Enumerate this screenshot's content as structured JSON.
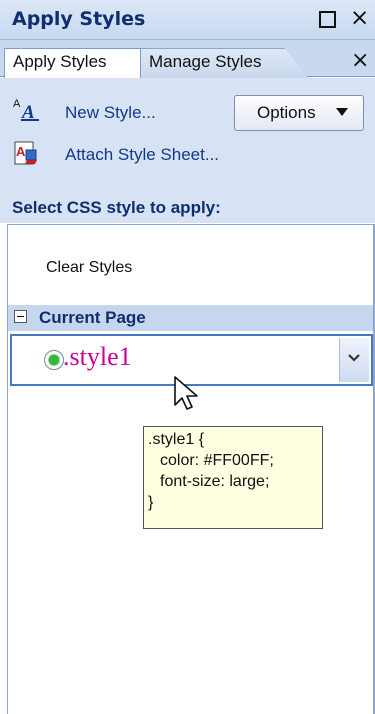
{
  "window": {
    "title": "Apply Styles"
  },
  "tabs": [
    {
      "label": "Apply Styles",
      "active": true
    },
    {
      "label": "Manage Styles",
      "active": false
    }
  ],
  "actions": {
    "new_style": "New Style...",
    "attach_style_sheet": "Attach Style Sheet...",
    "options": "Options"
  },
  "select_label": "Select CSS style to apply:",
  "list": {
    "clear_styles": "Clear Styles",
    "group_label": "Current Page",
    "items": [
      {
        "name": ".style1"
      }
    ]
  },
  "tooltip": {
    "lines": [
      ".style1 {",
      "color: #FF00FF;",
      "font-size: large;",
      "}"
    ]
  },
  "icons": {
    "window_close": "×",
    "tab_close": "×"
  },
  "colors": {
    "accent": "#0e2f6e",
    "style_color": "#c8009c",
    "tooltip_bg": "#ffffe1",
    "panel_bg": "#d7e3f4"
  }
}
